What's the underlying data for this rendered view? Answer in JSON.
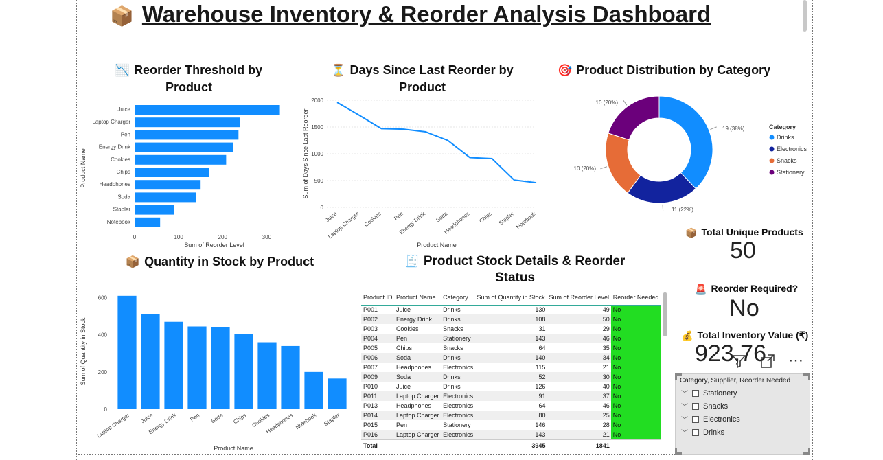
{
  "header": {
    "title": "Warehouse Inventory & Reorder Analysis Dashboard",
    "title_icon": "package-icon"
  },
  "visuals": {
    "reorder_threshold": {
      "title_line1": "Reorder Threshold by",
      "title_line2": "Product",
      "icon": "chart-decreasing-icon"
    },
    "days_since": {
      "title_line1": "Days Since Last Reorder by",
      "title_line2": "Product",
      "icon": "hourglass-icon"
    },
    "distribution": {
      "title": "Product Distribution by Category",
      "icon": "target-icon"
    },
    "quantity": {
      "title": "Quantity in Stock by Product",
      "icon": "package-icon"
    },
    "details": {
      "title_line1": "Product Stock Details & Reorder",
      "title_line2": "Status",
      "icon": "receipt-icon"
    }
  },
  "kpis": {
    "unique_products": {
      "label": "Total Unique Products",
      "value": "50",
      "icon": "package-icon"
    },
    "reorder_required": {
      "label": "Reorder Required?",
      "value": "No",
      "icon": "siren-icon"
    },
    "inventory_value": {
      "label": "Total Inventory Value (₹)",
      "value": "923,76",
      "icon": "money-bag-icon"
    }
  },
  "table": {
    "columns": [
      "Product ID",
      "Product Name",
      "Category",
      "Sum of Quantity in Stock",
      "Sum of Reorder Level",
      "Reorder Needed"
    ],
    "rows": [
      [
        "P001",
        "Juice",
        "Drinks",
        "130",
        "49",
        "No"
      ],
      [
        "P002",
        "Energy Drink",
        "Drinks",
        "108",
        "50",
        "No"
      ],
      [
        "P003",
        "Cookies",
        "Snacks",
        "31",
        "29",
        "No"
      ],
      [
        "P004",
        "Pen",
        "Stationery",
        "143",
        "46",
        "No"
      ],
      [
        "P005",
        "Chips",
        "Snacks",
        "64",
        "35",
        "No"
      ],
      [
        "P006",
        "Soda",
        "Drinks",
        "140",
        "34",
        "No"
      ],
      [
        "P007",
        "Headphones",
        "Electronics",
        "115",
        "21",
        "No"
      ],
      [
        "P009",
        "Soda",
        "Drinks",
        "52",
        "30",
        "No"
      ],
      [
        "P010",
        "Juice",
        "Drinks",
        "126",
        "40",
        "No"
      ],
      [
        "P011",
        "Laptop Charger",
        "Electronics",
        "91",
        "37",
        "No"
      ],
      [
        "P013",
        "Headphones",
        "Electronics",
        "64",
        "46",
        "No"
      ],
      [
        "P014",
        "Laptop Charger",
        "Electronics",
        "80",
        "25",
        "No"
      ],
      [
        "P015",
        "Pen",
        "Stationery",
        "146",
        "28",
        "No"
      ],
      [
        "P016",
        "Laptop Charger",
        "Electronics",
        "143",
        "21",
        "No"
      ]
    ],
    "total": [
      "Total",
      "",
      "",
      "3945",
      "1841",
      ""
    ]
  },
  "slicer": {
    "title": "Category, Supplier, Reorder Needed",
    "items": [
      "Stationery",
      "Snacks",
      "Electronics",
      "Drinks"
    ]
  },
  "colors": {
    "bar": "#118DFF",
    "drinks": "#118DFF",
    "electronics": "#12239E",
    "snacks": "#E66C37",
    "stationery": "#6B007B",
    "flag": "#22dd22"
  },
  "chart_data": [
    {
      "type": "bar",
      "orientation": "horizontal",
      "categories": [
        "Juice",
        "Laptop Charger",
        "Pen",
        "Energy Drink",
        "Cookies",
        "Chips",
        "Headphones",
        "Soda",
        "Stapler",
        "Notebook"
      ],
      "values": [
        330,
        240,
        236,
        224,
        208,
        170,
        150,
        140,
        90,
        58
      ],
      "xlabel": "Sum of Reorder Level",
      "ylabel": "Product Name",
      "xticks": [
        "0",
        "100",
        "200",
        "300"
      ],
      "xlim": [
        0,
        340
      ]
    },
    {
      "type": "line",
      "categories": [
        "Juice",
        "Laptop Charger",
        "Cookies",
        "Pen",
        "Energy Drink",
        "Soda",
        "Headphones",
        "Chips",
        "Stapler",
        "Notebook"
      ],
      "values": [
        1960,
        1720,
        1470,
        1460,
        1410,
        1250,
        930,
        910,
        510,
        460
      ],
      "xlabel": "Product Name",
      "ylabel": "Sum of Days Since Last Reorder",
      "yticks": [
        "0",
        "500",
        "1000",
        "1500",
        "2000"
      ],
      "ylim": [
        0,
        2000
      ]
    },
    {
      "type": "pie",
      "donut": true,
      "legend_title": "Category",
      "slices": [
        {
          "label": "Drinks",
          "value": 19,
          "data_label": "19 (38%)"
        },
        {
          "label": "Electronics",
          "value": 11,
          "data_label": "11 (22%)"
        },
        {
          "label": "Snacks",
          "value": 10,
          "data_label": "10 (20%)"
        },
        {
          "label": "Stationery",
          "value": 10,
          "data_label": "10 (20%)"
        }
      ]
    },
    {
      "type": "bar",
      "orientation": "vertical",
      "categories": [
        "Laptop Charger",
        "Juice",
        "Energy Drink",
        "Pen",
        "Soda",
        "Chips",
        "Cookies",
        "Headphones",
        "Notebook",
        "Stapler"
      ],
      "values": [
        610,
        510,
        470,
        445,
        440,
        405,
        360,
        340,
        200,
        165
      ],
      "xlabel": "Product Name",
      "ylabel": "Sum of Quantity in Stock",
      "yticks": [
        "0",
        "200",
        "400",
        "600"
      ],
      "ylim": [
        0,
        650
      ]
    }
  ]
}
